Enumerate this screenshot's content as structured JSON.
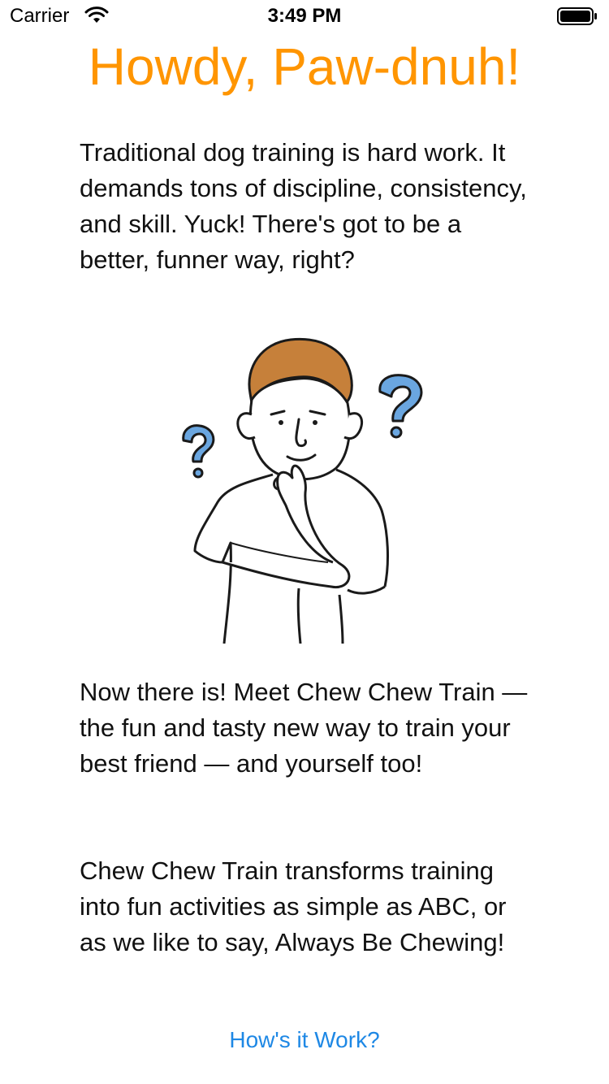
{
  "status_bar": {
    "carrier": "Carrier",
    "time": "3:49 PM"
  },
  "title": "Howdy, Paw-dnuh!",
  "paragraphs": {
    "intro": "Traditional dog training is hard work. It demands tons of discipline, consistency, and skill. Yuck! There's got to be a better, funner way, right?",
    "meet": "Now there is! Meet Chew Chew Train — the fun and tasty new way to train your best friend — and yourself too!",
    "transforms": "Chew Chew Train transforms training into fun activities as simple as ABC, or as we like to say, Always Be Chewing!"
  },
  "illustration": {
    "icon": "thinking-person-illustration"
  },
  "cta": {
    "label": "How's it Work?"
  },
  "colors": {
    "title": "#FF9500",
    "link": "#1E88E5",
    "question_marks": "#6AA6E0",
    "hair": "#C6803A"
  }
}
